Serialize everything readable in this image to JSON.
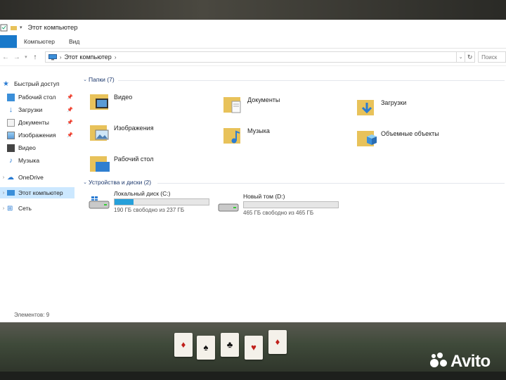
{
  "window": {
    "title": "Этот компьютер"
  },
  "ribbon": {
    "tabs": [
      "Компьютер",
      "Вид"
    ]
  },
  "address": {
    "path_label": "Этот компьютер",
    "search_placeholder": "Поиск"
  },
  "sidebar": {
    "quick_access": "Быстрый доступ",
    "items": [
      {
        "label": "Рабочий стол",
        "pinned": true
      },
      {
        "label": "Загрузки",
        "pinned": true
      },
      {
        "label": "Документы",
        "pinned": true
      },
      {
        "label": "Изображения",
        "pinned": true
      },
      {
        "label": "Видео",
        "pinned": false
      },
      {
        "label": "Музыка",
        "pinned": false
      }
    ],
    "onedrive": "OneDrive",
    "this_pc": "Этот компьютер",
    "network": "Сеть"
  },
  "folders_group": {
    "header": "Папки (7)"
  },
  "folders": [
    {
      "label": "Видео"
    },
    {
      "label": "Документы"
    },
    {
      "label": "Загрузки"
    },
    {
      "label": "Изображения"
    },
    {
      "label": "Музыка"
    },
    {
      "label": "Объемные объекты"
    },
    {
      "label": "Рабочий стол"
    }
  ],
  "drives_group": {
    "header": "Устройства и диски (2)"
  },
  "drives": [
    {
      "name": "Локальный диск (C:)",
      "free_text": "190 ГБ свободно из 237 ГБ",
      "used_fraction": 0.2
    },
    {
      "name": "Новый том (D:)",
      "free_text": "465 ГБ свободно из 465 ГБ",
      "used_fraction": 0.0
    }
  ],
  "status": {
    "items": "Элементов: 9"
  },
  "watermark": {
    "text": "Avito"
  },
  "colors": {
    "accent": "#1979ca",
    "selection": "#cce8ff",
    "drive_bar": "#26a0da",
    "folder": "#e8c25a"
  }
}
